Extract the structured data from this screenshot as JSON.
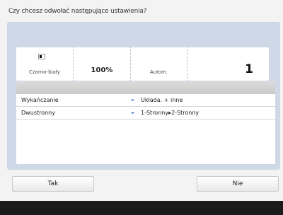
{
  "dialog": {
    "prompt": "Czy chcesz odwołać następujące ustawienia?"
  },
  "summary": {
    "color_icon": "color-mode-icon",
    "color_label": "Czarno-biały",
    "zoom_value": "100%",
    "paper_label": "Autom.",
    "copies_value": "1"
  },
  "settings": [
    {
      "name": "Wykańczanie",
      "value": "Układa. + inne"
    },
    {
      "name": "Dwustronny",
      "value": "1-Stronny▸2-Stronny"
    }
  ],
  "buttons": {
    "yes_label": "Tak",
    "no_label": "Nie"
  },
  "colors": {
    "panel": "#cfd8e6",
    "arrow": "#3a7fd0"
  }
}
